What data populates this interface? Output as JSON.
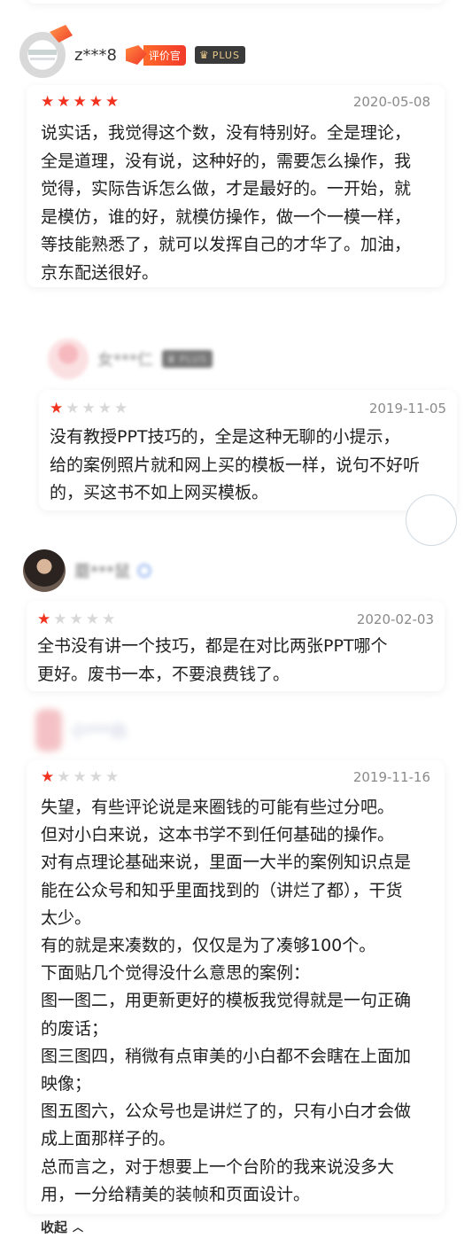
{
  "reviews": [
    {
      "username": "z***8",
      "badges": {
        "evaluator": "评价官",
        "plus": "PLUS"
      },
      "rating": 5,
      "date": "2020-05-08",
      "text": "说实话，我觉得这个数，没有特别好。全是理论，\n全是道理，没有说，这种好的，需要怎么操作，我\n觉得，实际告诉怎么做，才是最好的。一开始，就\n是模仿，谁的好，就模仿操作，做一个一模一样，\n等技能熟悉了，就可以发挥自己的才华了。加油，\n京东配送很好。"
    },
    {
      "username": "女***仁",
      "badges": {
        "plus": "PLUS"
      },
      "rating": 1,
      "date": "2019-11-05",
      "text": "没有教授PPT技巧的，全是这种无聊的小提示，\n给的案例照片就和网上买的模板一样，说句不好听\n的，买这书不如上网买模板。"
    },
    {
      "username": "蘑***鼠",
      "rating": 1,
      "date": "2020-02-03",
      "text": "全书没有讲一个技巧，都是在对比两张PPT哪个\n更好。废书一本，不要浪费钱了。"
    },
    {
      "username": "小***白",
      "rating": 1,
      "date": "2019-11-16",
      "text": "失望，有些评论说是来圈钱的可能有些过分吧。\n但对小白来说，这本书学不到任何基础的操作。\n对有点理论基础来说，里面一大半的案例知识点是\n能在公众号和知乎里面找到的（讲烂了都），干货\n太少。\n有的就是来凑数的，仅仅是为了凑够100个。\n下面贴几个觉得没什么意思的案例：\n图一图二，用更新更好的模板我觉得就是一句正确\n的废话；\n图三图四，稍微有点审美的小白都不会瞎在上面加\n映像；\n图五图六，公众号也是讲烂了的，只有小白才会做\n成上面那样子的。\n总而言之，对于想要上一个台阶的我来说没多大\n用，一分给精美的装帧和页面设计。"
    }
  ],
  "collapse_label": "收起",
  "colors": {
    "star_on": "#f2311f",
    "star_off": "#d8d8d8",
    "date": "#8a8a8a"
  },
  "icons": {
    "star": "star-icon",
    "chevron": "chevron-up-icon",
    "crown": "crown-icon"
  }
}
